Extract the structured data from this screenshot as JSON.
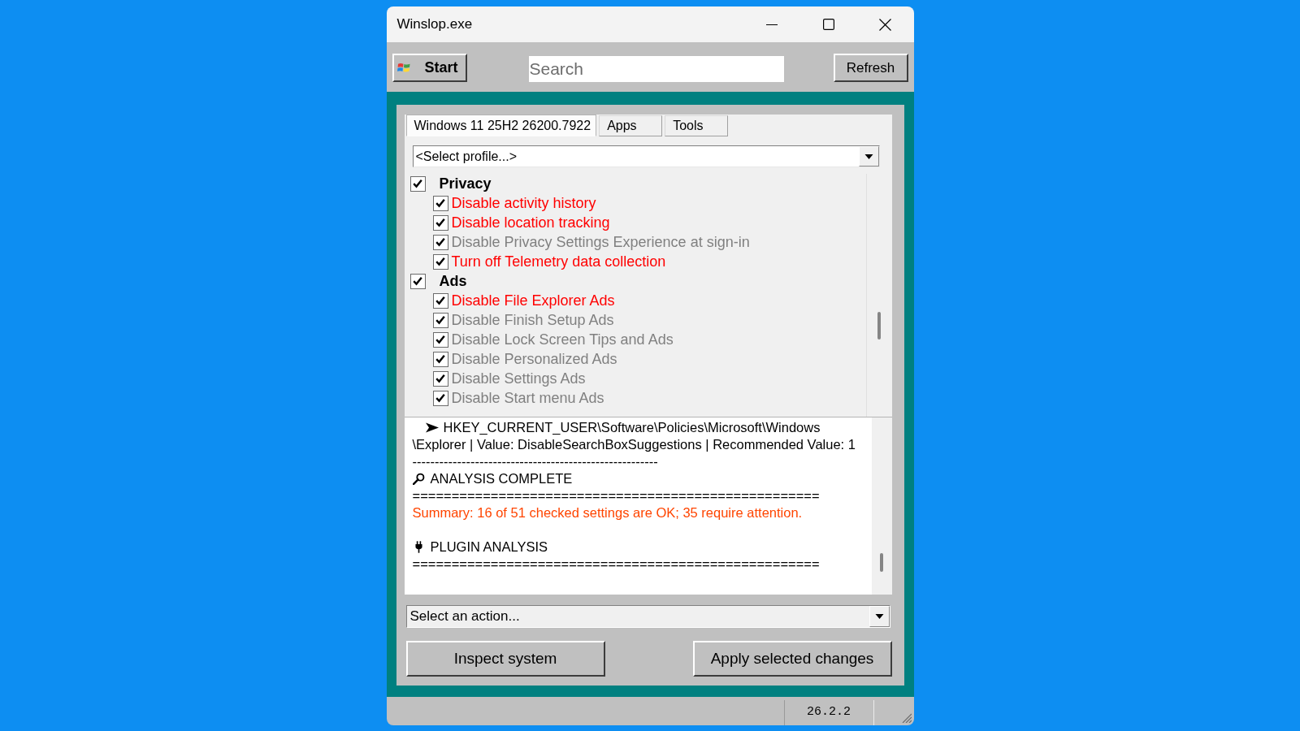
{
  "window": {
    "title": "Winslop.exe"
  },
  "toolbar": {
    "start_button": "Start",
    "search": {
      "placeholder": "Search"
    },
    "refresh_button": "Refresh"
  },
  "tabs": [
    {
      "label": "Windows 11 25H2 26200.7922",
      "selected": true
    },
    {
      "label": "Apps",
      "selected": false
    },
    {
      "label": "Tools",
      "selected": false
    }
  ],
  "profile_select": {
    "value": "<Select profile...>"
  },
  "settings": [
    {
      "label": "Privacy",
      "checked": true,
      "children": [
        {
          "label": "Disable activity history",
          "checked": true,
          "color": "#ff0000"
        },
        {
          "label": "Disable location tracking",
          "checked": true,
          "color": "#ff0000"
        },
        {
          "label": "Disable Privacy Settings Experience at sign-in",
          "checked": true,
          "color": "#808080"
        },
        {
          "label": "Turn off Telemetry data collection",
          "checked": true,
          "color": "#ff0000"
        }
      ]
    },
    {
      "label": "Ads",
      "checked": true,
      "children": [
        {
          "label": "Disable File Explorer Ads",
          "checked": true,
          "color": "#ff0000"
        },
        {
          "label": "Disable Finish Setup Ads",
          "checked": true,
          "color": "#808080"
        },
        {
          "label": "Disable Lock Screen Tips and Ads",
          "checked": true,
          "color": "#808080"
        },
        {
          "label": "Disable Personalized Ads",
          "checked": true,
          "color": "#808080"
        },
        {
          "label": "Disable Settings Ads",
          "checked": true,
          "color": "#808080"
        },
        {
          "label": "Disable Start menu Ads",
          "checked": true,
          "color": "#808080"
        }
      ]
    }
  ],
  "log": [
    {
      "kind": "entry",
      "text": "HKEY_CURRENT_USER\\Software\\Policies\\Microsoft\\Windows"
    },
    {
      "kind": "plain",
      "text": "\\Explorer | Value: DisableSearchBoxSuggestions | Recommended Value: 1"
    },
    {
      "kind": "separator",
      "text": "-------------------------------------------------------"
    },
    {
      "kind": "analysis_heading",
      "text": "ANALYSIS COMPLETE"
    },
    {
      "kind": "separator",
      "text": "===================================================="
    },
    {
      "kind": "summary",
      "text": "Summary: 16 of 51 checked settings are OK; 35 require attention."
    },
    {
      "kind": "plugin_heading",
      "text": "PLUGIN ANALYSIS"
    },
    {
      "kind": "separator",
      "text": "===================================================="
    }
  ],
  "action_select": {
    "value": "Select an action..."
  },
  "buttons": [
    "Inspect system",
    "Apply selected changes"
  ],
  "status_bar": {
    "version": "26.2.2"
  }
}
